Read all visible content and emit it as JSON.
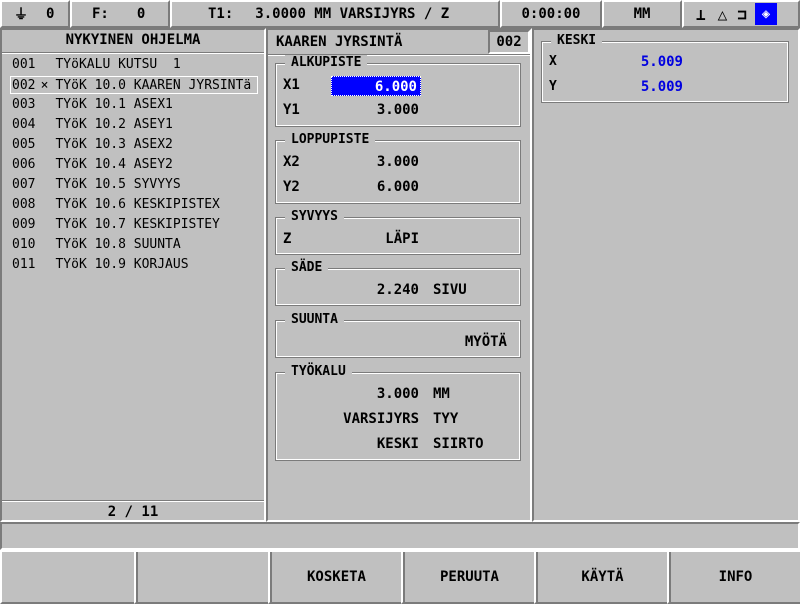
{
  "status_bar": {
    "axis_icon": "axis-ground-icon",
    "axis_value": "0",
    "feed_label": "F:",
    "feed_value": "0",
    "tool_label": "T1:",
    "tool_info": "3.0000 MM VARSIJYRS / Z",
    "time": "0:00:00",
    "units": "MM",
    "icons": [
      "ground-symbol-icon",
      "delta-icon",
      "bracket-icon",
      "diamond-icon"
    ]
  },
  "program_list": {
    "title": "NYKYINEN OHJELMA",
    "rows": [
      {
        "num": "001",
        "mark": " ",
        "text": "TYöKALU KUTSU  1"
      },
      {
        "num": "002",
        "mark": "×",
        "text": "TYöK 10.0 KAAREN JYRSINTä"
      },
      {
        "num": "003",
        "mark": " ",
        "text": "TYöK 10.1 ASEX1"
      },
      {
        "num": "004",
        "mark": " ",
        "text": "TYöK 10.2 ASEY1"
      },
      {
        "num": "005",
        "mark": " ",
        "text": "TYöK 10.3 ASEX2"
      },
      {
        "num": "006",
        "mark": " ",
        "text": "TYöK 10.4 ASEY2"
      },
      {
        "num": "007",
        "mark": " ",
        "text": "TYöK 10.5 SYVYYS"
      },
      {
        "num": "008",
        "mark": " ",
        "text": "TYöK 10.6 KESKIPISTEX"
      },
      {
        "num": "009",
        "mark": " ",
        "text": "TYöK 10.7 KESKIPISTEY"
      },
      {
        "num": "010",
        "mark": " ",
        "text": "TYöK 10.8 SUUNTA"
      },
      {
        "num": "011",
        "mark": " ",
        "text": "TYöK 10.9 KORJAUS"
      }
    ],
    "page": "2 / 11"
  },
  "form": {
    "title": "KAAREN JYRSINTÄ",
    "step": "002",
    "alkupiste": {
      "title": "ALKUPISTE",
      "x1_label": "X1",
      "x1_value": "6.000",
      "y1_label": "Y1",
      "y1_value": "3.000"
    },
    "loppupiste": {
      "title": "LOPPUPISTE",
      "x2_label": "X2",
      "x2_value": "3.000",
      "y2_label": "Y2",
      "y2_value": "6.000"
    },
    "syvyys": {
      "title": "SYVYYS",
      "z_label": "Z",
      "z_value": "LÄPI"
    },
    "sade": {
      "title": "SÄDE",
      "value": "2.240",
      "unit": "SIVU"
    },
    "suunta": {
      "title": "SUUNTA",
      "value": "MYÖTÄ"
    },
    "tyokalu": {
      "title": "TYÖKALU",
      "diam": "3.000",
      "diam_unit": "MM",
      "type_label": "VARSIJYRS",
      "type_value": "TYY",
      "offset_label": "KESKI",
      "offset_value": "SIIRTO"
    }
  },
  "keski": {
    "title": "KESKI",
    "x_label": "X",
    "x_value": "5.009",
    "y_label": "Y",
    "y_value": "5.009"
  },
  "softkeys": [
    "",
    "",
    "KOSKETA",
    "PERUUTA",
    "KÄYTÄ",
    "INFO"
  ],
  "colors": {
    "accent": "#0000ff",
    "value_blue": "#0000e0",
    "bg": "#c0c0c0"
  }
}
